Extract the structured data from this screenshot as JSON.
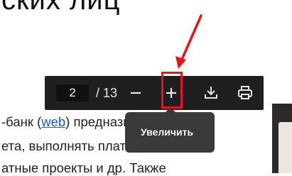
{
  "document": {
    "heading": "ских лиц",
    "line1_prefix": "-банк (",
    "line1_link": "web",
    "line1_suffix": ") предназначены",
    "line2": "ета, выполнять платежи и",
    "line3": "атные проекты и др. Также"
  },
  "pdf_toolbar": {
    "page_current": "2",
    "page_total_label": "/ 13",
    "zoom_out_icon": "minus-icon",
    "zoom_in_icon": "plus-icon",
    "download_icon": "download-icon",
    "print_icon": "printer-icon"
  },
  "tooltip": {
    "text": "Увеличить"
  },
  "annotation": {
    "color": "#e8141b"
  }
}
